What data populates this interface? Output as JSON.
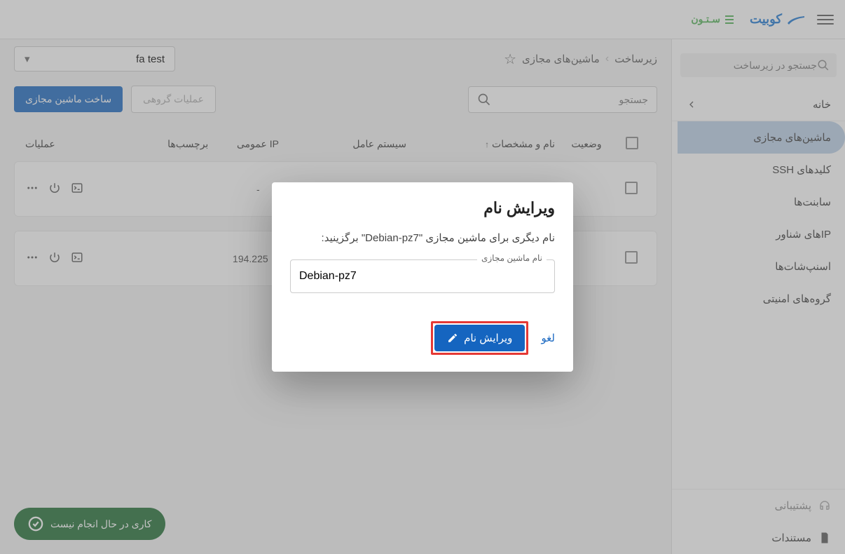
{
  "header": {
    "brand_primary": "کوبیت",
    "brand_secondary": "سـتـون"
  },
  "sidebar": {
    "search_placeholder": "جستجو در زیرساخت",
    "home": "خانه",
    "items": [
      "ماشین‌های مجازی",
      "کلیدهای SSH",
      "سابنت‌ها",
      "IPهای شناور",
      "اسنپ‌شات‌ها",
      "گروه‌های امنیتی"
    ],
    "support": "پشتیبانی",
    "docs": "مستندات"
  },
  "breadcrumb": {
    "root": "زیرساخت",
    "current": "ماشین‌های مجازی"
  },
  "project_selector": "fa test",
  "toolbar": {
    "search_placeholder": "جستجو",
    "group_ops": "عملیات گروهی",
    "create_vm": "ساخت ماشین مجازی"
  },
  "table": {
    "headers": {
      "status": "وضعیت",
      "name": "نام و مشخصات",
      "os": "سیستم عامل",
      "ip": "IP عمومی",
      "tags": "برچسب‌ها",
      "actions": "عملیات"
    },
    "rows": [
      {
        "ip": "-"
      },
      {
        "ip": "194.225"
      }
    ]
  },
  "modal": {
    "title": "ویرایش نام",
    "description": "نام دیگری برای ماشین مجازی \"Debian-pz7\" برگزینید:",
    "field_label": "نام ماشین مجازی",
    "field_value": "Debian-pz7",
    "cancel": "لغو",
    "confirm": "ویرایش نام"
  },
  "status_pill": "کاری در حال انجام نیست"
}
